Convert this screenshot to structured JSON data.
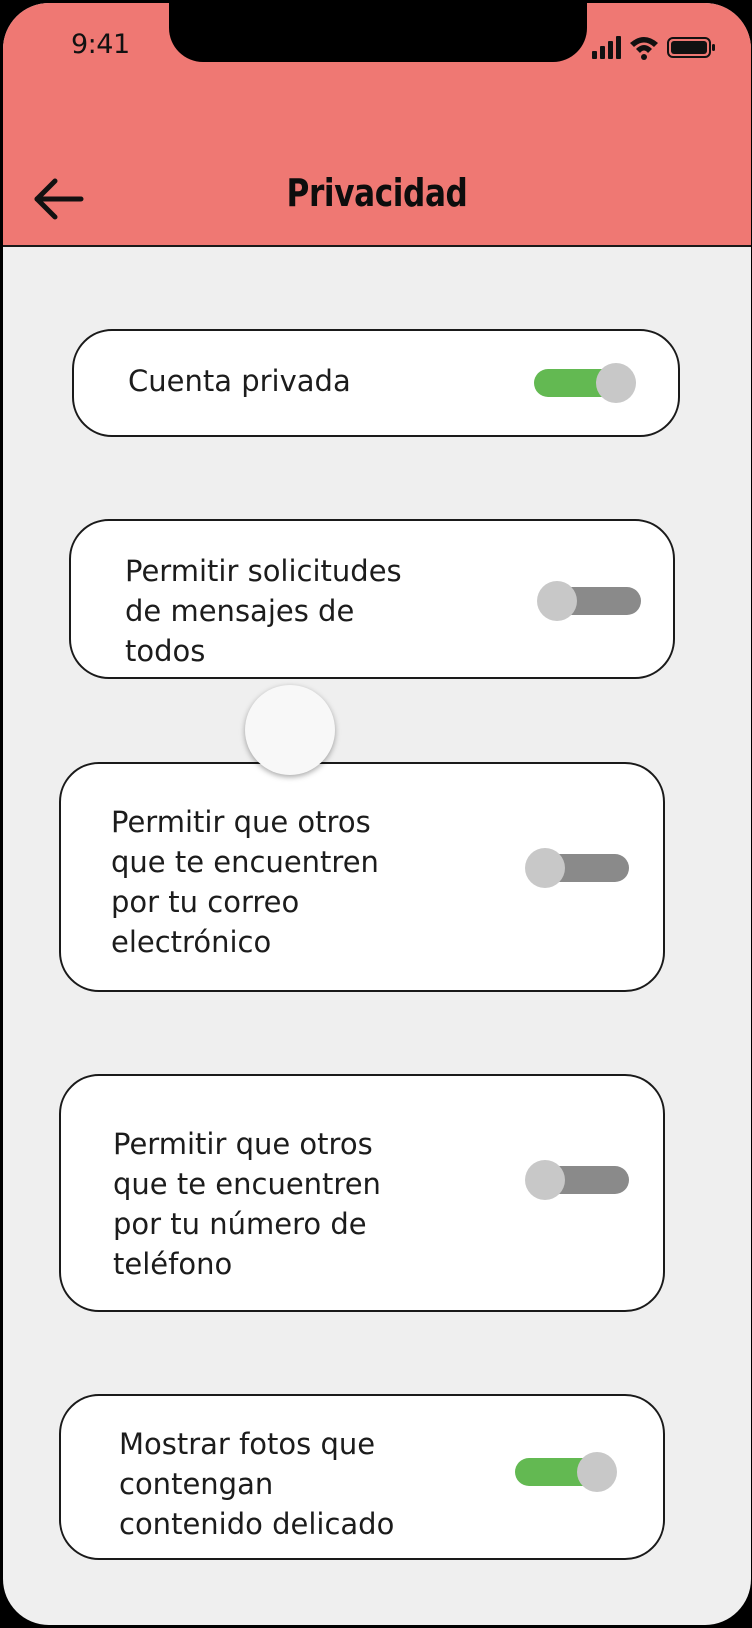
{
  "status_bar": {
    "time": "9:41",
    "icons": [
      "cellular-signal-icon",
      "wifi-icon",
      "battery-icon"
    ]
  },
  "header": {
    "title": "Privacidad",
    "back_icon": "arrow-left-icon",
    "background_color": "#EF7873"
  },
  "settings": [
    {
      "label": "Cuenta privada",
      "enabled": true
    },
    {
      "label": "Permitir solicitudes\nde mensajes de\ntodos",
      "enabled": false
    },
    {
      "label": "Permitir que otros\nque te encuentren\npor tu correo\nelectrónico",
      "enabled": false
    },
    {
      "label": "Permitir que otros\nque te encuentren\npor tu número de\nteléfono",
      "enabled": false
    },
    {
      "label": "Mostrar fotos que\ncontengan\ncontenido delicado",
      "enabled": true
    }
  ],
  "colors": {
    "toggle_on": "#63B952",
    "toggle_off": "#8A8A8A",
    "knob": "#C8C8C8",
    "background": "#EFEFEF"
  }
}
